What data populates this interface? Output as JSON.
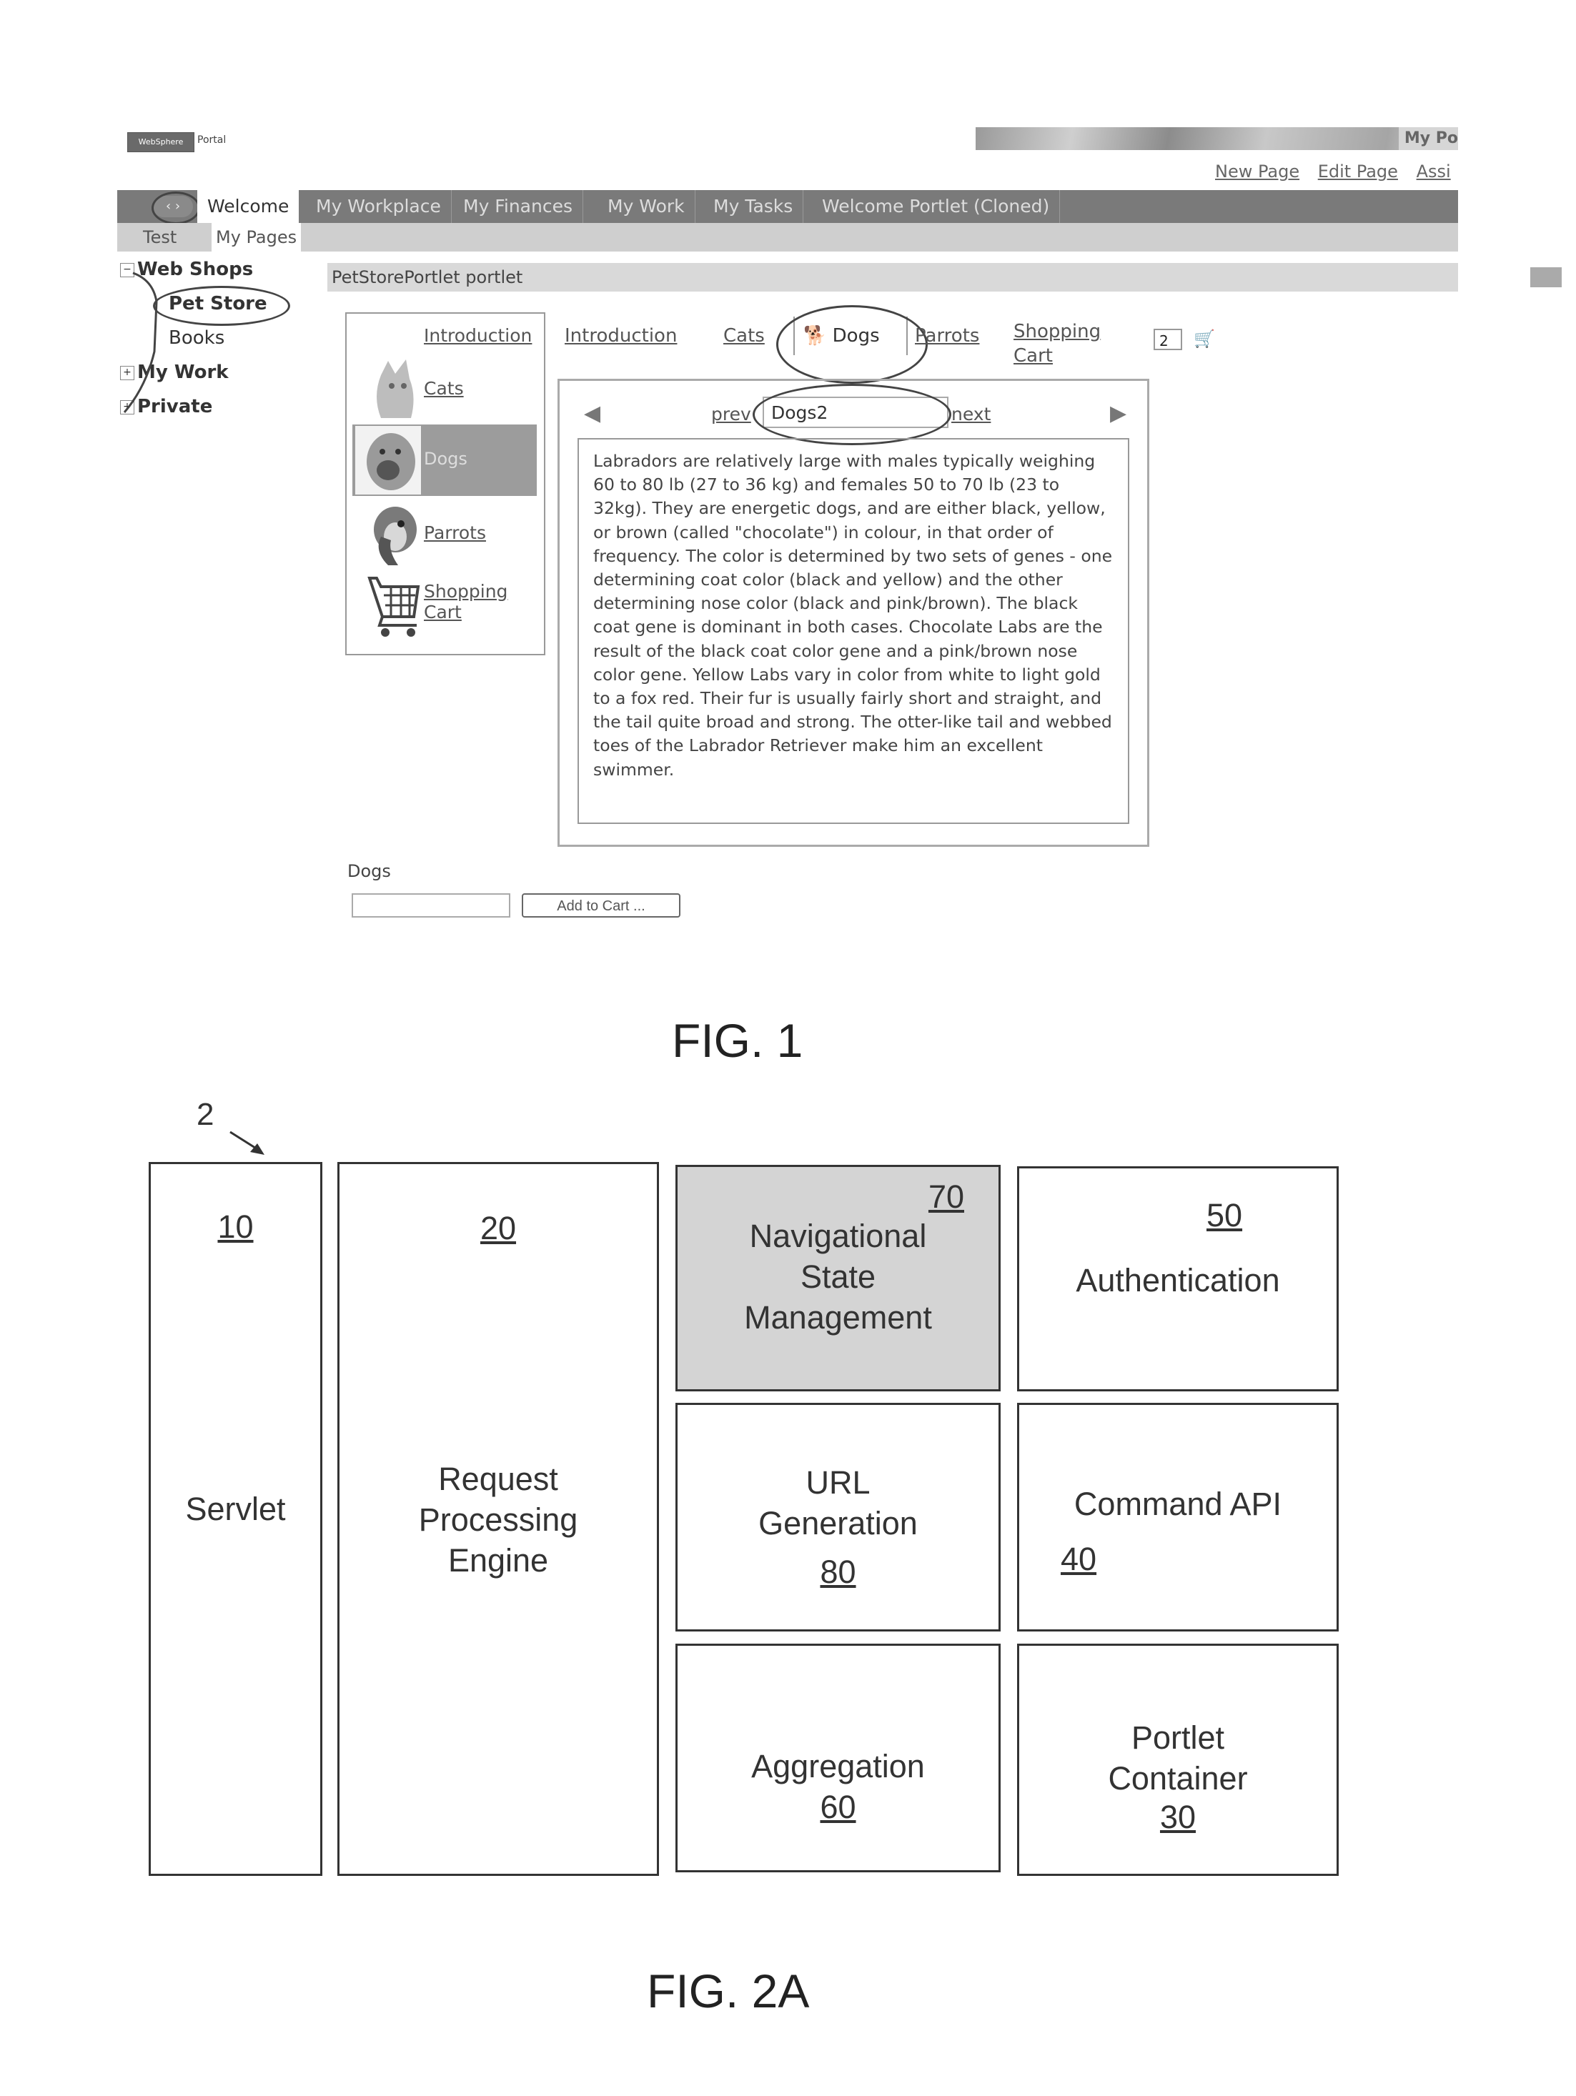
{
  "figure1": {
    "caption": "FIG. 1",
    "header": {
      "logo_text": "WebSphere",
      "logo_subtext": "Portal",
      "banner_title": "My Po",
      "top_links": [
        "New Page",
        "Edit Page",
        "Assi"
      ]
    },
    "nav": {
      "arrows": "‹ ›",
      "tabs": [
        {
          "label": "Welcome",
          "active": true
        },
        {
          "label": "My Workplace",
          "active": false
        },
        {
          "label": "My Finances",
          "active": false
        },
        {
          "label": "My Work",
          "active": false
        },
        {
          "label": "My Tasks",
          "active": false
        },
        {
          "label": "Welcome Portlet (Cloned)",
          "active": false
        }
      ],
      "subtabs": [
        "Test",
        "My Pages"
      ]
    },
    "tree": {
      "items": [
        {
          "label": "Web Shops",
          "expander": "−"
        },
        {
          "label": "Pet Store"
        },
        {
          "label": "Books"
        },
        {
          "label": "My Work",
          "expander": "+"
        },
        {
          "label": "Private",
          "expander": "+"
        }
      ]
    },
    "portlet": {
      "title": "PetStorePortlet portlet",
      "title_highlight": "PetStorePortlet port",
      "side_menu": {
        "introduction": "Introduction",
        "cats": "Cats",
        "dogs": "Dogs",
        "parrots": "Parrots",
        "shopping_cart_line1": "Shopping",
        "shopping_cart_line2": "Cart"
      },
      "tabs": {
        "introduction": "Introduction",
        "cats": "Cats",
        "dogs": "Dogs",
        "parrots": "Parrots",
        "shopping_cart_line1": "Shopping",
        "shopping_cart_line2": "Cart"
      },
      "cart_quantity": "2",
      "pager": {
        "prev": "prev",
        "current": "Dogs2",
        "next": "next"
      },
      "body_text": "Labradors are relatively large with males typically weighing 60 to 80 lb (27 to 36 kg) and females 50 to 70 lb (23 to 32kg). They are energetic dogs, and are either black, yellow, or brown (called \"chocolate\") in colour, in that order of frequency. The color is determined by two sets of genes - one determining coat color (black and yellow) and the other determining nose color (black and pink/brown). The black coat gene is dominant in both cases. Chocolate Labs are the result of the black coat color gene and a pink/brown nose color gene. Yellow Labs vary in color from white to light gold to a fox red. Their fur is usually fairly short and straight, and the tail quite broad and strong. The otter-like tail and webbed toes of the Labrador Retriever make him an excellent swimmer.",
      "form": {
        "label": "Dogs",
        "input_value": "",
        "button_label": "Add to Cart ..."
      }
    }
  },
  "figure2a": {
    "caption": "FIG. 2A",
    "reference_numeral": "2",
    "blocks": [
      {
        "id": "servlet",
        "label": "Servlet",
        "ref": "10",
        "shaded": false
      },
      {
        "id": "request-processing-engine",
        "label": "Request Processing Engine",
        "ref": "20",
        "shaded": false
      },
      {
        "id": "navigational-state-management",
        "label": "Navigational State Management",
        "ref": "70",
        "shaded": true
      },
      {
        "id": "authentication",
        "label": "Authentication",
        "ref": "50",
        "shaded": false
      },
      {
        "id": "url-generation",
        "label": "URL Generation",
        "ref": "80",
        "shaded": false
      },
      {
        "id": "command-api",
        "label": "Command API",
        "ref": "40",
        "shaded": false
      },
      {
        "id": "aggregation",
        "label": "Aggregation",
        "ref": "60",
        "shaded": false
      },
      {
        "id": "portlet-container",
        "label": "Portlet Container",
        "ref": "30",
        "shaded": false
      }
    ]
  }
}
